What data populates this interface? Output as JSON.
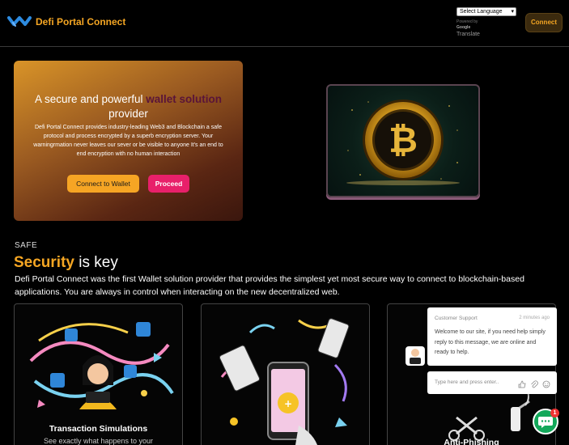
{
  "header": {
    "brand": "Defi Portal Connect",
    "language_select": "Select Language",
    "powered_by": "Powered by",
    "google": "Google",
    "translate": "Translate",
    "connect_label": "Connect"
  },
  "hero": {
    "title_pre": "A secure and powerful ",
    "title_highlight": "wallet solution",
    "title_post": "provider",
    "body": "Defi Portal Connect provides industry-leading Web3 and Blockchain a safe protocol and process encrypted by a superb encryption server. Your warningrmation never leaves our sever or be visible to anyone It's an end to end encryption with no human interaction",
    "connect_wallet_label": "Connect to Wallet",
    "proceed_label": "Proceed"
  },
  "security": {
    "eyebrow": "SAFE",
    "heading_accent": "Security",
    "heading_rest": " is key",
    "description": "Defi Portal Connect was the first Wallet solution provider that provides the simplest yet most secure way to connect to blockchain-based applications. You are always in control when interacting on the new decentralized web."
  },
  "features": [
    {
      "title": "Transaction Simulations",
      "subtitle": "See exactly what happens to your"
    },
    {
      "title": "",
      "subtitle": ""
    },
    {
      "title": "Anti-Phishing",
      "subtitle": ""
    }
  ],
  "chat": {
    "agent": "Customer Support",
    "time": "2 minutes ago",
    "message": "Welcome to our site, if you need help simply reply to this message, we are online and ready to help.",
    "input_placeholder": "Type here and press enter..",
    "badge_count": "1"
  },
  "colors": {
    "accent": "#f5a623",
    "proceed": "#e8206a",
    "chat_green": "#13a85a"
  }
}
